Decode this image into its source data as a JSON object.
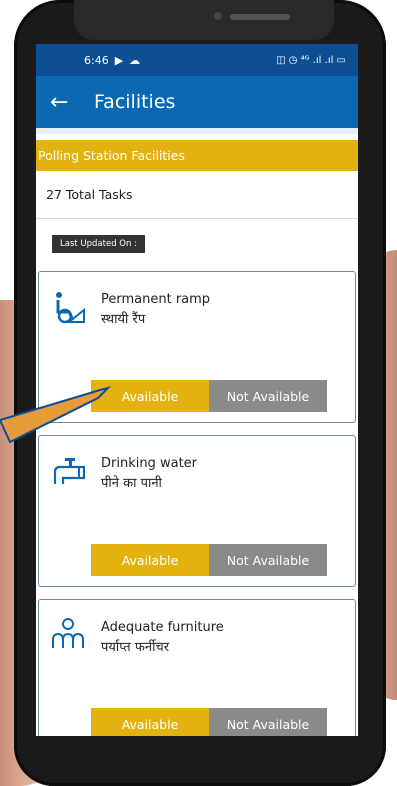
{
  "status": {
    "time": "6:46",
    "right_icons": "◫ ◷ ⁴ᴳ .ıl .ıl ▭"
  },
  "appbar": {
    "title": "Facilities"
  },
  "section": {
    "title": "Polling Station Facilities"
  },
  "tasks": {
    "total": "27 Total Tasks"
  },
  "last_updated": {
    "label": "Last Updated On :"
  },
  "cards": [
    {
      "name_en": "Permanent ramp",
      "name_hi": "स्थायी रैंप",
      "available": "Available",
      "not_available": "Not Available",
      "icon": "wheelchair-icon"
    },
    {
      "name_en": "Drinking water",
      "name_hi": "पीने का पानी",
      "available": "Available",
      "not_available": "Not Available",
      "icon": "water-tap-icon"
    },
    {
      "name_en": "Adequate furniture",
      "name_hi": "पर्याप्त फर्नीचर",
      "available": "Available",
      "not_available": "Not Available",
      "icon": "furniture-icon"
    }
  ],
  "colors": {
    "status_bar": "#0c4f92",
    "app_bar": "#0b69b4",
    "accent": "#e4b20f",
    "not_available": "#8a8a8a"
  }
}
